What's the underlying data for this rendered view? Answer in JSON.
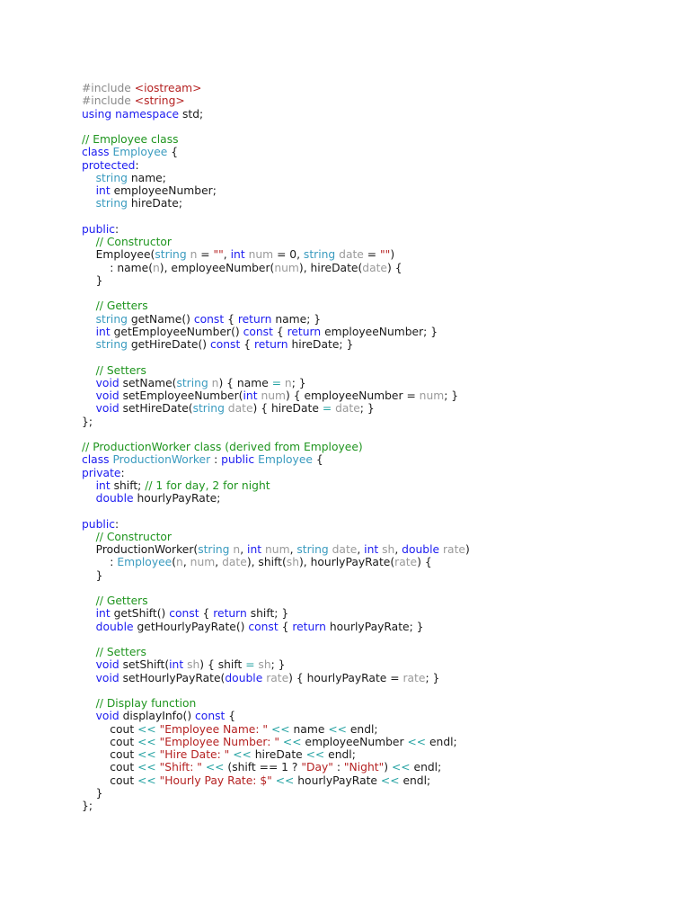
{
  "token_colors": {
    "keyword": "#1c1cf0",
    "type": "#3a9bbf",
    "comment": "#1f951f",
    "string": "#b52222",
    "preprocessor": "#8a8a8a",
    "parameter": "#9a9a9a",
    "operator": "#27a3a3",
    "plain": "#1a1a1a"
  },
  "lines": [
    [
      [
        "p",
        "#include "
      ],
      [
        "s",
        "<iostream>"
      ]
    ],
    [
      [
        "p",
        "#include "
      ],
      [
        "s",
        "<string>"
      ]
    ],
    [
      [
        "k",
        "using namespace"
      ],
      [
        "n",
        " std;"
      ]
    ],
    [],
    [
      [
        "c",
        "// Employee class"
      ]
    ],
    [
      [
        "k",
        "class "
      ],
      [
        "t",
        "Employee"
      ],
      [
        "n",
        " {"
      ]
    ],
    [
      [
        "k",
        "protected"
      ],
      [
        "n",
        ":"
      ]
    ],
    [
      [
        "n",
        "    "
      ],
      [
        "t",
        "string"
      ],
      [
        "n",
        " name;"
      ]
    ],
    [
      [
        "n",
        "    "
      ],
      [
        "k",
        "int"
      ],
      [
        "n",
        " employeeNumber;"
      ]
    ],
    [
      [
        "n",
        "    "
      ],
      [
        "t",
        "string"
      ],
      [
        "n",
        " hireDate;"
      ]
    ],
    [],
    [
      [
        "k",
        "public"
      ],
      [
        "n",
        ":"
      ]
    ],
    [
      [
        "n",
        "    "
      ],
      [
        "c",
        "// Constructor"
      ]
    ],
    [
      [
        "n",
        "    Employee("
      ],
      [
        "t",
        "string"
      ],
      [
        "v",
        " n"
      ],
      [
        "n",
        " = "
      ],
      [
        "s",
        "\"\""
      ],
      [
        "n",
        ", "
      ],
      [
        "k",
        "int"
      ],
      [
        "v",
        " num"
      ],
      [
        "n",
        " = 0, "
      ],
      [
        "t",
        "string"
      ],
      [
        "v",
        " date"
      ],
      [
        "n",
        " = "
      ],
      [
        "s",
        "\"\""
      ],
      [
        "n",
        ")"
      ]
    ],
    [
      [
        "n",
        "        : name("
      ],
      [
        "v",
        "n"
      ],
      [
        "n",
        "), employeeNumber("
      ],
      [
        "v",
        "num"
      ],
      [
        "n",
        "), hireDate("
      ],
      [
        "v",
        "date"
      ],
      [
        "n",
        ") {"
      ]
    ],
    [
      [
        "n",
        "    }"
      ]
    ],
    [],
    [
      [
        "n",
        "    "
      ],
      [
        "c",
        "// Getters"
      ]
    ],
    [
      [
        "n",
        "    "
      ],
      [
        "t",
        "string"
      ],
      [
        "n",
        " getName() "
      ],
      [
        "k",
        "const"
      ],
      [
        "n",
        " { "
      ],
      [
        "k",
        "return"
      ],
      [
        "n",
        " name; }"
      ]
    ],
    [
      [
        "n",
        "    "
      ],
      [
        "k",
        "int"
      ],
      [
        "n",
        " getEmployeeNumber() "
      ],
      [
        "k",
        "const"
      ],
      [
        "n",
        " { "
      ],
      [
        "k",
        "return"
      ],
      [
        "n",
        " employeeNumber; }"
      ]
    ],
    [
      [
        "n",
        "    "
      ],
      [
        "t",
        "string"
      ],
      [
        "n",
        " getHireDate() "
      ],
      [
        "k",
        "const"
      ],
      [
        "n",
        " { "
      ],
      [
        "k",
        "return"
      ],
      [
        "n",
        " hireDate; }"
      ]
    ],
    [],
    [
      [
        "n",
        "    "
      ],
      [
        "c",
        "// Setters"
      ]
    ],
    [
      [
        "n",
        "    "
      ],
      [
        "k",
        "void"
      ],
      [
        "n",
        " setName("
      ],
      [
        "t",
        "string"
      ],
      [
        "v",
        " n"
      ],
      [
        "n",
        ") { name "
      ],
      [
        "o",
        "="
      ],
      [
        "v",
        " n"
      ],
      [
        "n",
        "; }"
      ]
    ],
    [
      [
        "n",
        "    "
      ],
      [
        "k",
        "void"
      ],
      [
        "n",
        " setEmployeeNumber("
      ],
      [
        "k",
        "int"
      ],
      [
        "v",
        " num"
      ],
      [
        "n",
        ") { employeeNumber = "
      ],
      [
        "v",
        "num"
      ],
      [
        "n",
        "; }"
      ]
    ],
    [
      [
        "n",
        "    "
      ],
      [
        "k",
        "void"
      ],
      [
        "n",
        " setHireDate("
      ],
      [
        "t",
        "string"
      ],
      [
        "v",
        " date"
      ],
      [
        "n",
        ") { hireDate "
      ],
      [
        "o",
        "="
      ],
      [
        "v",
        " date"
      ],
      [
        "n",
        "; }"
      ]
    ],
    [
      [
        "n",
        "};"
      ]
    ],
    [],
    [
      [
        "c",
        "// ProductionWorker class (derived from Employee)"
      ]
    ],
    [
      [
        "k",
        "class "
      ],
      [
        "t",
        "ProductionWorker"
      ],
      [
        "n",
        " : "
      ],
      [
        "k",
        "public"
      ],
      [
        "t",
        " Employee"
      ],
      [
        "n",
        " {"
      ]
    ],
    [
      [
        "k",
        "private"
      ],
      [
        "n",
        ":"
      ]
    ],
    [
      [
        "n",
        "    "
      ],
      [
        "k",
        "int"
      ],
      [
        "n",
        " shift; "
      ],
      [
        "c",
        "// 1 for day, 2 for night"
      ]
    ],
    [
      [
        "n",
        "    "
      ],
      [
        "k",
        "double"
      ],
      [
        "n",
        " hourlyPayRate;"
      ]
    ],
    [],
    [
      [
        "k",
        "public"
      ],
      [
        "n",
        ":"
      ]
    ],
    [
      [
        "n",
        "    "
      ],
      [
        "c",
        "// Constructor"
      ]
    ],
    [
      [
        "n",
        "    ProductionWorker("
      ],
      [
        "t",
        "string"
      ],
      [
        "v",
        " n"
      ],
      [
        "n",
        ", "
      ],
      [
        "k",
        "int"
      ],
      [
        "v",
        " num"
      ],
      [
        "n",
        ", "
      ],
      [
        "t",
        "string"
      ],
      [
        "v",
        " date"
      ],
      [
        "n",
        ", "
      ],
      [
        "k",
        "int"
      ],
      [
        "v",
        " sh"
      ],
      [
        "n",
        ", "
      ],
      [
        "k",
        "double"
      ],
      [
        "v",
        " rate"
      ],
      [
        "n",
        ")"
      ]
    ],
    [
      [
        "n",
        "        : "
      ],
      [
        "t",
        "Employee"
      ],
      [
        "n",
        "("
      ],
      [
        "v",
        "n"
      ],
      [
        "n",
        ", "
      ],
      [
        "v",
        "num"
      ],
      [
        "n",
        ", "
      ],
      [
        "v",
        "date"
      ],
      [
        "n",
        "), shift("
      ],
      [
        "v",
        "sh"
      ],
      [
        "n",
        "), hourlyPayRate("
      ],
      [
        "v",
        "rate"
      ],
      [
        "n",
        ") {"
      ]
    ],
    [
      [
        "n",
        "    }"
      ]
    ],
    [],
    [
      [
        "n",
        "    "
      ],
      [
        "c",
        "// Getters"
      ]
    ],
    [
      [
        "n",
        "    "
      ],
      [
        "k",
        "int"
      ],
      [
        "n",
        " getShift() "
      ],
      [
        "k",
        "const"
      ],
      [
        "n",
        " { "
      ],
      [
        "k",
        "return"
      ],
      [
        "n",
        " shift; }"
      ]
    ],
    [
      [
        "n",
        "    "
      ],
      [
        "k",
        "double"
      ],
      [
        "n",
        " getHourlyPayRate() "
      ],
      [
        "k",
        "const"
      ],
      [
        "n",
        " { "
      ],
      [
        "k",
        "return"
      ],
      [
        "n",
        " hourlyPayRate; }"
      ]
    ],
    [],
    [
      [
        "n",
        "    "
      ],
      [
        "c",
        "// Setters"
      ]
    ],
    [
      [
        "n",
        "    "
      ],
      [
        "k",
        "void"
      ],
      [
        "n",
        " setShift("
      ],
      [
        "k",
        "int"
      ],
      [
        "v",
        " sh"
      ],
      [
        "n",
        ") { shift "
      ],
      [
        "o",
        "="
      ],
      [
        "v",
        " sh"
      ],
      [
        "n",
        "; }"
      ]
    ],
    [
      [
        "n",
        "    "
      ],
      [
        "k",
        "void"
      ],
      [
        "n",
        " setHourlyPayRate("
      ],
      [
        "k",
        "double"
      ],
      [
        "v",
        " rate"
      ],
      [
        "n",
        ") { hourlyPayRate = "
      ],
      [
        "v",
        "rate"
      ],
      [
        "n",
        "; }"
      ]
    ],
    [],
    [
      [
        "n",
        "    "
      ],
      [
        "c",
        "// Display function"
      ]
    ],
    [
      [
        "n",
        "    "
      ],
      [
        "k",
        "void"
      ],
      [
        "n",
        " displayInfo() "
      ],
      [
        "k",
        "const"
      ],
      [
        "n",
        " {"
      ]
    ],
    [
      [
        "n",
        "        cout "
      ],
      [
        "o",
        "<<"
      ],
      [
        "n",
        " "
      ],
      [
        "s",
        "\"Employee Name: \""
      ],
      [
        "n",
        " "
      ],
      [
        "o",
        "<<"
      ],
      [
        "n",
        " name "
      ],
      [
        "o",
        "<<"
      ],
      [
        "n",
        " endl;"
      ]
    ],
    [
      [
        "n",
        "        cout "
      ],
      [
        "o",
        "<<"
      ],
      [
        "n",
        " "
      ],
      [
        "s",
        "\"Employee Number: \""
      ],
      [
        "n",
        " "
      ],
      [
        "o",
        "<<"
      ],
      [
        "n",
        " employeeNumber "
      ],
      [
        "o",
        "<<"
      ],
      [
        "n",
        " endl;"
      ]
    ],
    [
      [
        "n",
        "        cout "
      ],
      [
        "o",
        "<<"
      ],
      [
        "n",
        " "
      ],
      [
        "s",
        "\"Hire Date: \""
      ],
      [
        "n",
        " "
      ],
      [
        "o",
        "<<"
      ],
      [
        "n",
        " hireDate "
      ],
      [
        "o",
        "<<"
      ],
      [
        "n",
        " endl;"
      ]
    ],
    [
      [
        "n",
        "        cout "
      ],
      [
        "o",
        "<<"
      ],
      [
        "n",
        " "
      ],
      [
        "s",
        "\"Shift: \""
      ],
      [
        "n",
        " "
      ],
      [
        "o",
        "<<"
      ],
      [
        "n",
        " (shift == 1 ? "
      ],
      [
        "s",
        "\"Day\""
      ],
      [
        "n",
        " : "
      ],
      [
        "s",
        "\"Night\""
      ],
      [
        "n",
        ") "
      ],
      [
        "o",
        "<<"
      ],
      [
        "n",
        " endl;"
      ]
    ],
    [
      [
        "n",
        "        cout "
      ],
      [
        "o",
        "<<"
      ],
      [
        "n",
        " "
      ],
      [
        "s",
        "\"Hourly Pay Rate: $\""
      ],
      [
        "n",
        " "
      ],
      [
        "o",
        "<<"
      ],
      [
        "n",
        " hourlyPayRate "
      ],
      [
        "o",
        "<<"
      ],
      [
        "n",
        " endl;"
      ]
    ],
    [
      [
        "n",
        "    }"
      ]
    ],
    [
      [
        "n",
        "};"
      ]
    ]
  ]
}
